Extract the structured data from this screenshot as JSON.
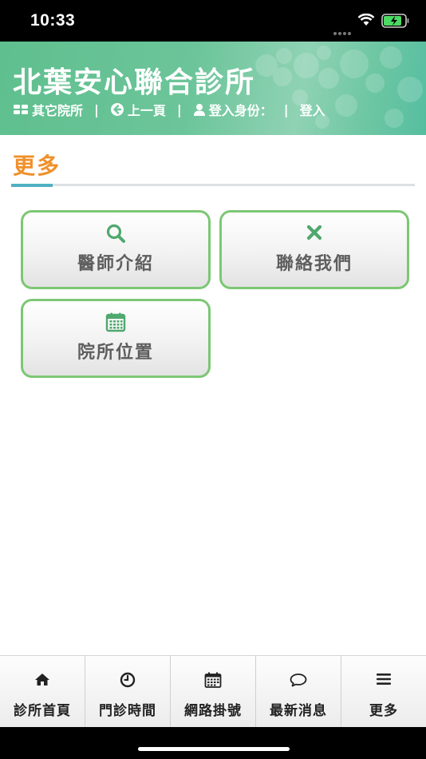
{
  "status_bar": {
    "time": "10:33"
  },
  "header": {
    "clinic_title": "北葉安心聯合診所",
    "nav": {
      "other_clinics": "其它院所",
      "separator": "|",
      "back": "上一頁",
      "login_identity": "登入身份：",
      "login": "登入"
    },
    "gradient_colors": [
      "#5fbf8e",
      "#8fd2b4",
      "#55bea0"
    ]
  },
  "section": {
    "title": "更多",
    "title_color": "#f0902a",
    "accent_color": "#4fb0c3"
  },
  "menu": {
    "border_color": "#7cc774",
    "icon_color": "#4fa86d",
    "items": [
      {
        "label": "醫師介紹",
        "icon": "search-icon"
      },
      {
        "label": "聯絡我們",
        "icon": "close-icon"
      },
      {
        "label": "院所位置",
        "icon": "calendar-icon"
      }
    ]
  },
  "tabbar": {
    "items": [
      {
        "label": "診所首頁",
        "icon": "home-icon"
      },
      {
        "label": "門診時間",
        "icon": "clock-icon"
      },
      {
        "label": "網路掛號",
        "icon": "calendar-icon"
      },
      {
        "label": "最新消息",
        "icon": "chat-icon"
      },
      {
        "label": "更多",
        "icon": "menu-icon"
      }
    ]
  }
}
